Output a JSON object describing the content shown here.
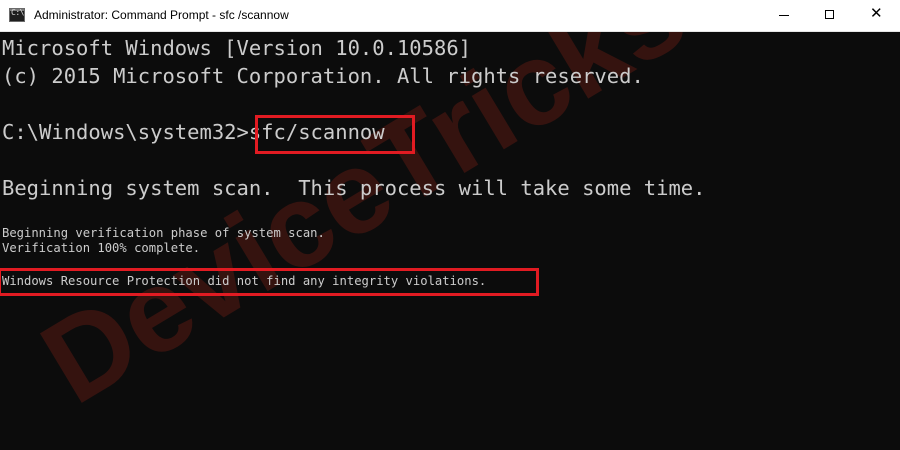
{
  "window": {
    "title": "Administrator: Command Prompt - sfc /scannow",
    "icon_glyph": "C:\\",
    "controls": {
      "minimize_icon": "minimize-icon",
      "maximize_icon": "maximize-icon",
      "close_icon": "close-icon",
      "close_glyph": "✕"
    }
  },
  "console": {
    "lines": {
      "version": "Microsoft Windows [Version 10.0.10586]",
      "copyright": "(c) 2015 Microsoft Corporation. All rights reserved.",
      "prompt": "C:\\Windows\\system32>",
      "command": "sfc/scannow",
      "begin_scan": "Beginning system scan.  This process will take some time.",
      "verification_phase": "Beginning verification phase of system scan.",
      "verification_complete": "Verification 100% complete.",
      "result": "Windows Resource Protection did not find any integrity violations."
    }
  },
  "watermark": {
    "text": "DeviceTricks"
  },
  "colors": {
    "console_background": "#0c0c0c",
    "console_text": "#cccccc",
    "highlight": "#e11b22",
    "watermark": "#3a1410"
  }
}
